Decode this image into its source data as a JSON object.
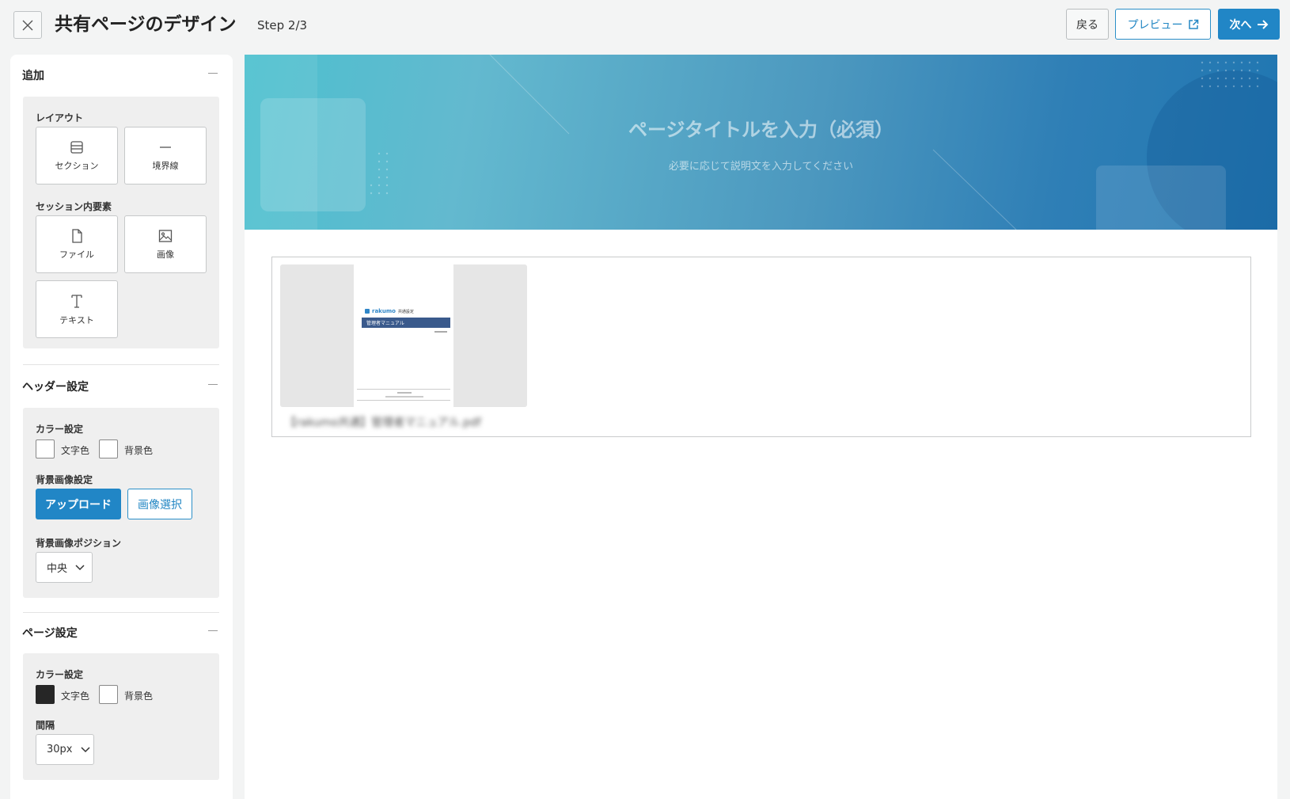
{
  "header": {
    "title": "共有ページのデザイン",
    "step": "Step 2/3",
    "back_label": "戻る",
    "preview_label": "プレビュー",
    "next_label": "次へ"
  },
  "sidebar": {
    "add": {
      "title": "追加",
      "layout_label": "レイアウト",
      "layout_items": [
        "セクション",
        "境界線"
      ],
      "session_label": "セッション内要素",
      "session_items": [
        "ファイル",
        "画像",
        "テキスト"
      ]
    },
    "header_settings": {
      "title": "ヘッダー設定",
      "color_label": "カラー設定",
      "text_color_label": "文字色",
      "bg_color_label": "背景色",
      "text_color": "#ffffff",
      "bg_color": "#ffffff",
      "bg_image_label": "背景画像設定",
      "upload_label": "アップロード",
      "select_image_label": "画像選択",
      "position_label": "背景画像ポジション",
      "position_value": "中央"
    },
    "page_settings": {
      "title": "ページ設定",
      "color_label": "カラー設定",
      "text_color_label": "文字色",
      "bg_color_label": "背景色",
      "text_color": "#262626",
      "bg_color": "#ffffff",
      "spacing_label": "間隔",
      "spacing_value": "30px"
    }
  },
  "canvas": {
    "hero_title": "ページタイトルを入力（必須）",
    "hero_subtitle": "必要に応じて説明文を入力してください",
    "file": {
      "name": "【rakumo共通】管理者マニュアル.pdf",
      "doc_brand": "rakumo",
      "doc_brand_sub": "共通設定",
      "doc_heading": "管理者マニュアル"
    }
  },
  "colors": {
    "accent": "#2186c6",
    "page_bg": "#f3f4f4"
  }
}
